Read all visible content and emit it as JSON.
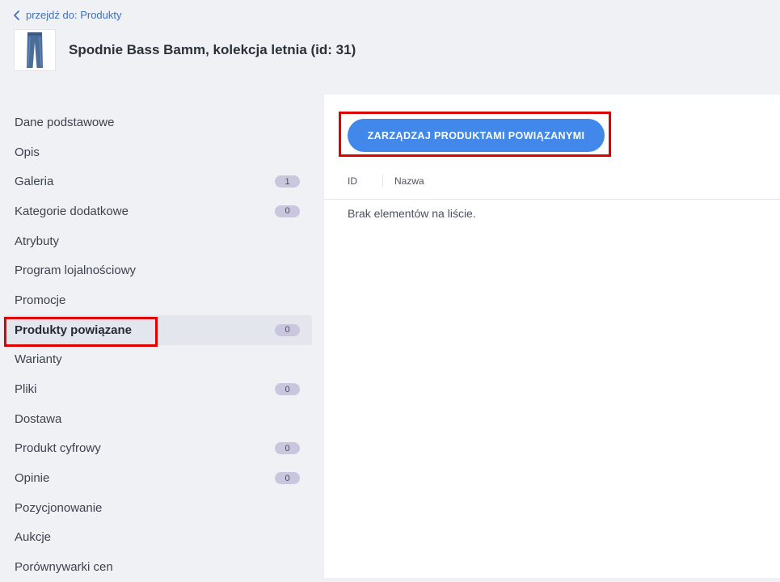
{
  "breadcrumb": {
    "label": "przejdź do: Produkty"
  },
  "product": {
    "title": "Spodnie Bass Bamm, kolekcja letnia (id: 31)"
  },
  "sidebar": {
    "items": [
      {
        "label": "Dane podstawowe"
      },
      {
        "label": "Opis"
      },
      {
        "label": "Galeria",
        "badge": "1"
      },
      {
        "label": "Kategorie dodatkowe",
        "badge": "0"
      },
      {
        "label": "Atrybuty"
      },
      {
        "label": "Program lojalnościowy"
      },
      {
        "label": "Promocje"
      },
      {
        "label": "Produkty powiązane",
        "badge": "0",
        "active": true
      },
      {
        "label": "Warianty"
      },
      {
        "label": "Pliki",
        "badge": "0"
      },
      {
        "label": "Dostawa"
      },
      {
        "label": "Produkt cyfrowy",
        "badge": "0"
      },
      {
        "label": "Opinie",
        "badge": "0"
      },
      {
        "label": "Pozycjonowanie"
      },
      {
        "label": "Aukcje"
      },
      {
        "label": "Porównywarki cen"
      }
    ]
  },
  "main": {
    "manage_button": "ZARZĄDZAJ PRODUKTAMI POWIĄZANYMI",
    "table": {
      "columns": [
        "ID",
        "Nazwa"
      ]
    },
    "empty_message": "Brak elementów na liście."
  },
  "colors": {
    "accent": "#4287ea",
    "highlight": "#e00000",
    "badge": "#c9c6de",
    "link": "#3f6fbf"
  },
  "icons": {
    "back": "chevron-left-icon",
    "product_thumbnail": "jeans-thumbnail"
  }
}
